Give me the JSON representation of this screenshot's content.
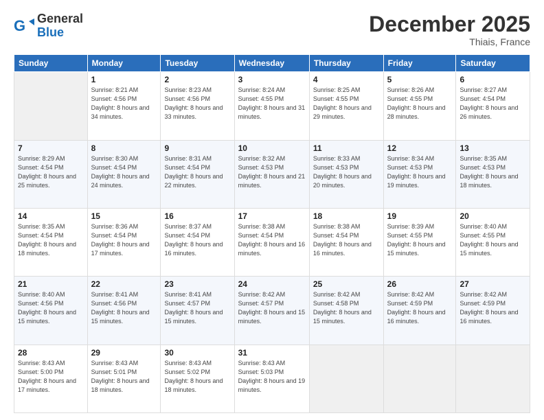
{
  "header": {
    "logo_general": "General",
    "logo_blue": "Blue",
    "month_title": "December 2025",
    "location": "Thiais, France"
  },
  "days_of_week": [
    "Sunday",
    "Monday",
    "Tuesday",
    "Wednesday",
    "Thursday",
    "Friday",
    "Saturday"
  ],
  "weeks": [
    [
      {
        "day": null
      },
      {
        "day": 1,
        "sunrise": "8:21 AM",
        "sunset": "4:56 PM",
        "daylight": "8 hours and 34 minutes."
      },
      {
        "day": 2,
        "sunrise": "8:23 AM",
        "sunset": "4:56 PM",
        "daylight": "8 hours and 33 minutes."
      },
      {
        "day": 3,
        "sunrise": "8:24 AM",
        "sunset": "4:55 PM",
        "daylight": "8 hours and 31 minutes."
      },
      {
        "day": 4,
        "sunrise": "8:25 AM",
        "sunset": "4:55 PM",
        "daylight": "8 hours and 29 minutes."
      },
      {
        "day": 5,
        "sunrise": "8:26 AM",
        "sunset": "4:55 PM",
        "daylight": "8 hours and 28 minutes."
      },
      {
        "day": 6,
        "sunrise": "8:27 AM",
        "sunset": "4:54 PM",
        "daylight": "8 hours and 26 minutes."
      }
    ],
    [
      {
        "day": 7,
        "sunrise": "8:29 AM",
        "sunset": "4:54 PM",
        "daylight": "8 hours and 25 minutes."
      },
      {
        "day": 8,
        "sunrise": "8:30 AM",
        "sunset": "4:54 PM",
        "daylight": "8 hours and 24 minutes."
      },
      {
        "day": 9,
        "sunrise": "8:31 AM",
        "sunset": "4:54 PM",
        "daylight": "8 hours and 22 minutes."
      },
      {
        "day": 10,
        "sunrise": "8:32 AM",
        "sunset": "4:53 PM",
        "daylight": "8 hours and 21 minutes."
      },
      {
        "day": 11,
        "sunrise": "8:33 AM",
        "sunset": "4:53 PM",
        "daylight": "8 hours and 20 minutes."
      },
      {
        "day": 12,
        "sunrise": "8:34 AM",
        "sunset": "4:53 PM",
        "daylight": "8 hours and 19 minutes."
      },
      {
        "day": 13,
        "sunrise": "8:35 AM",
        "sunset": "4:53 PM",
        "daylight": "8 hours and 18 minutes."
      }
    ],
    [
      {
        "day": 14,
        "sunrise": "8:35 AM",
        "sunset": "4:54 PM",
        "daylight": "8 hours and 18 minutes."
      },
      {
        "day": 15,
        "sunrise": "8:36 AM",
        "sunset": "4:54 PM",
        "daylight": "8 hours and 17 minutes."
      },
      {
        "day": 16,
        "sunrise": "8:37 AM",
        "sunset": "4:54 PM",
        "daylight": "8 hours and 16 minutes."
      },
      {
        "day": 17,
        "sunrise": "8:38 AM",
        "sunset": "4:54 PM",
        "daylight": "8 hours and 16 minutes."
      },
      {
        "day": 18,
        "sunrise": "8:38 AM",
        "sunset": "4:54 PM",
        "daylight": "8 hours and 16 minutes."
      },
      {
        "day": 19,
        "sunrise": "8:39 AM",
        "sunset": "4:55 PM",
        "daylight": "8 hours and 15 minutes."
      },
      {
        "day": 20,
        "sunrise": "8:40 AM",
        "sunset": "4:55 PM",
        "daylight": "8 hours and 15 minutes."
      }
    ],
    [
      {
        "day": 21,
        "sunrise": "8:40 AM",
        "sunset": "4:56 PM",
        "daylight": "8 hours and 15 minutes."
      },
      {
        "day": 22,
        "sunrise": "8:41 AM",
        "sunset": "4:56 PM",
        "daylight": "8 hours and 15 minutes."
      },
      {
        "day": 23,
        "sunrise": "8:41 AM",
        "sunset": "4:57 PM",
        "daylight": "8 hours and 15 minutes."
      },
      {
        "day": 24,
        "sunrise": "8:42 AM",
        "sunset": "4:57 PM",
        "daylight": "8 hours and 15 minutes."
      },
      {
        "day": 25,
        "sunrise": "8:42 AM",
        "sunset": "4:58 PM",
        "daylight": "8 hours and 15 minutes."
      },
      {
        "day": 26,
        "sunrise": "8:42 AM",
        "sunset": "4:59 PM",
        "daylight": "8 hours and 16 minutes."
      },
      {
        "day": 27,
        "sunrise": "8:42 AM",
        "sunset": "4:59 PM",
        "daylight": "8 hours and 16 minutes."
      }
    ],
    [
      {
        "day": 28,
        "sunrise": "8:43 AM",
        "sunset": "5:00 PM",
        "daylight": "8 hours and 17 minutes."
      },
      {
        "day": 29,
        "sunrise": "8:43 AM",
        "sunset": "5:01 PM",
        "daylight": "8 hours and 18 minutes."
      },
      {
        "day": 30,
        "sunrise": "8:43 AM",
        "sunset": "5:02 PM",
        "daylight": "8 hours and 18 minutes."
      },
      {
        "day": 31,
        "sunrise": "8:43 AM",
        "sunset": "5:03 PM",
        "daylight": "8 hours and 19 minutes."
      },
      {
        "day": null
      },
      {
        "day": null
      },
      {
        "day": null
      }
    ]
  ]
}
